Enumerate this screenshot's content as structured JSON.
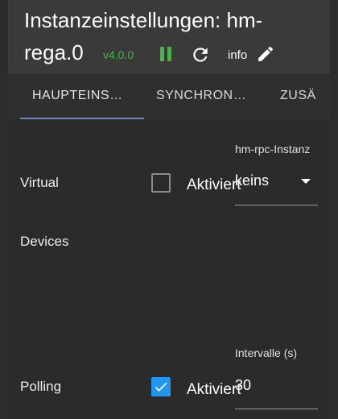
{
  "dialog": {
    "title_line1": "Instanzeinstellungen: hm-",
    "title_line2": "rega.0",
    "version": "v4.0.0",
    "info_label": "info"
  },
  "tabs": [
    {
      "label": "HAUPTEINS…",
      "active": true
    },
    {
      "label": "SYNCHRON…",
      "active": false
    },
    {
      "label": "ZUSÄ",
      "active": false
    }
  ],
  "settings": {
    "virtual_devices": {
      "label_line1": "Virtual",
      "label_line2": "Devices",
      "checkbox_label": "Aktiviert",
      "checked": false
    },
    "rpc_instance": {
      "label": "hm-rpc-Instanz",
      "value": "keins"
    },
    "polling": {
      "label": "Polling",
      "checkbox_label": "Aktiviert",
      "checked": true
    },
    "interval": {
      "label": "Intervalle (s)",
      "value": "30"
    }
  },
  "colors": {
    "accent_green": "#4caf50",
    "checkbox_blue": "#2196f3",
    "tab_indicator": "#6a88b8"
  },
  "icons": [
    "pause-icon",
    "reload-icon",
    "edit-pencil-icon",
    "dropdown-arrow-icon",
    "check-icon"
  ]
}
